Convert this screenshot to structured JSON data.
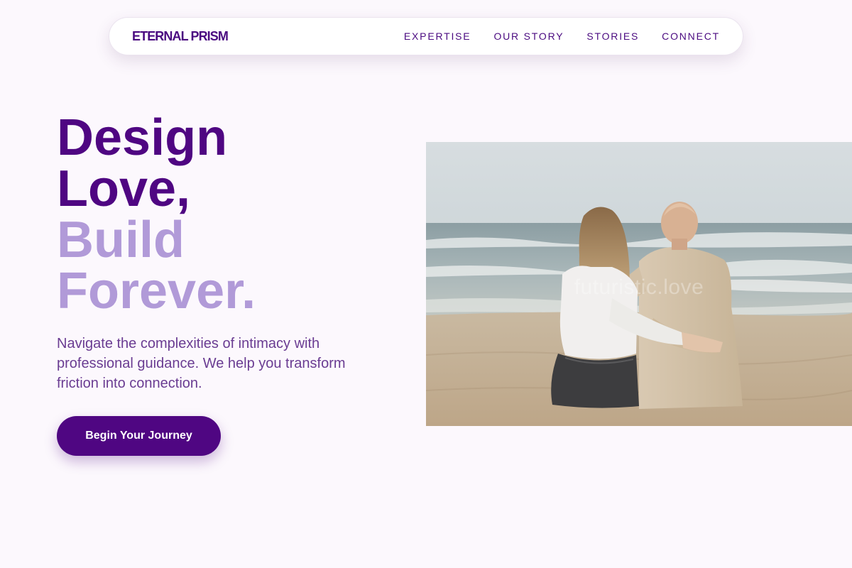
{
  "nav": {
    "brand": "ETERNAL PRISM",
    "links": [
      "EXPERTISE",
      "OUR STORY",
      "STORIES",
      "CONNECT"
    ]
  },
  "hero": {
    "title_lines": [
      "Design",
      "Love,",
      "Build",
      "Forever."
    ],
    "description": "Navigate the complexities of intimacy with professional guidance. We help you transform friction into connection.",
    "cta_label": "Begin Your Journey",
    "image_watermark": "futuristic.love"
  },
  "colors": {
    "background": "#fcf8fd",
    "primary": "#4f0682",
    "accent_light": "#b19ad8",
    "body_text": "#6a3c92",
    "nav_text": "#4a0a80"
  }
}
